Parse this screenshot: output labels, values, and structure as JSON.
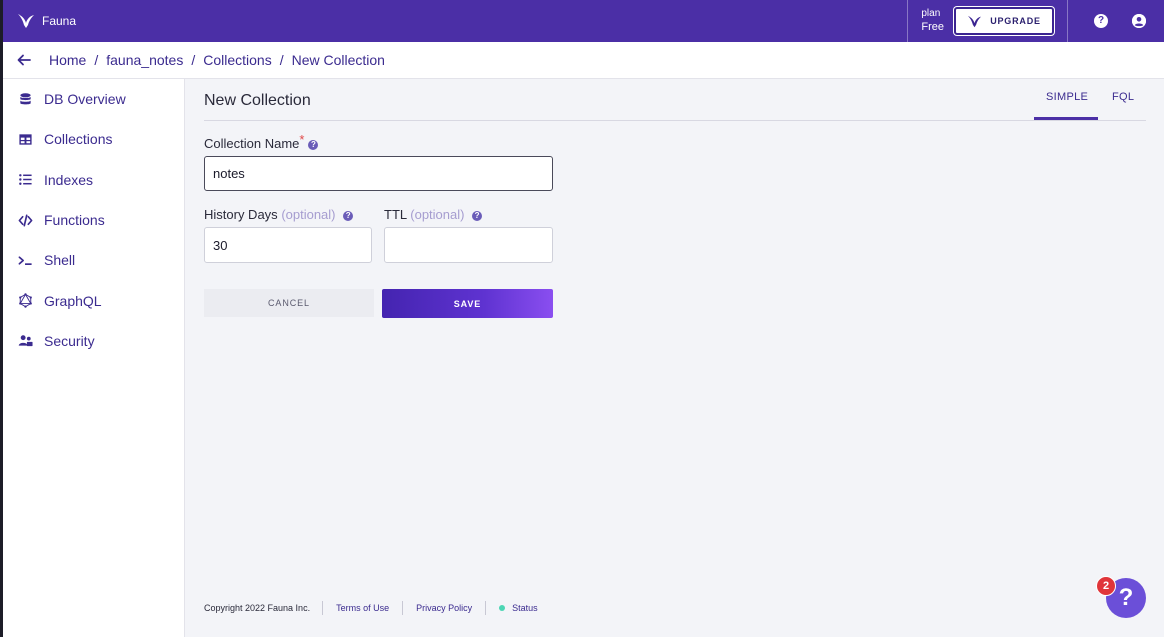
{
  "app": {
    "name": "Fauna"
  },
  "header": {
    "plan_label": "plan",
    "plan_value": "Free",
    "upgrade_label": "UPGRADE",
    "help_icon": "question-circle-icon",
    "account_icon": "user-circle-icon"
  },
  "breadcrumb": {
    "items": [
      "Home",
      "fauna_notes",
      "Collections",
      "New Collection"
    ],
    "separator": "/"
  },
  "sidebar": {
    "items": [
      {
        "label": "DB Overview",
        "icon": "database-icon"
      },
      {
        "label": "Collections",
        "icon": "table-icon"
      },
      {
        "label": "Indexes",
        "icon": "list-icon"
      },
      {
        "label": "Functions",
        "icon": "code-icon"
      },
      {
        "label": "Shell",
        "icon": "terminal-icon"
      },
      {
        "label": "GraphQL",
        "icon": "graphql-icon"
      },
      {
        "label": "Security",
        "icon": "users-icon"
      }
    ]
  },
  "main": {
    "title": "New Collection",
    "tabs": [
      {
        "label": "SIMPLE",
        "active": true
      },
      {
        "label": "FQL",
        "active": false
      }
    ],
    "form": {
      "collection_name_label": "Collection Name",
      "required_mark": "*",
      "collection_name_value": "notes",
      "history_days_label": "History Days",
      "ttl_label": "TTL",
      "optional_text": "(optional)",
      "history_days_value": "30",
      "ttl_value": "",
      "cancel_label": "CANCEL",
      "save_label": "SAVE"
    }
  },
  "footer": {
    "copyright": "Copyright 2022 Fauna Inc.",
    "terms": "Terms of Use",
    "privacy": "Privacy Policy",
    "status": "Status"
  },
  "help_widget": {
    "badge_count": "2",
    "symbol": "?"
  },
  "colors": {
    "brand": "#4b2fa6",
    "link": "#3b2b8f",
    "status_ok": "#4cd6b4",
    "badge": "#e0353a"
  }
}
